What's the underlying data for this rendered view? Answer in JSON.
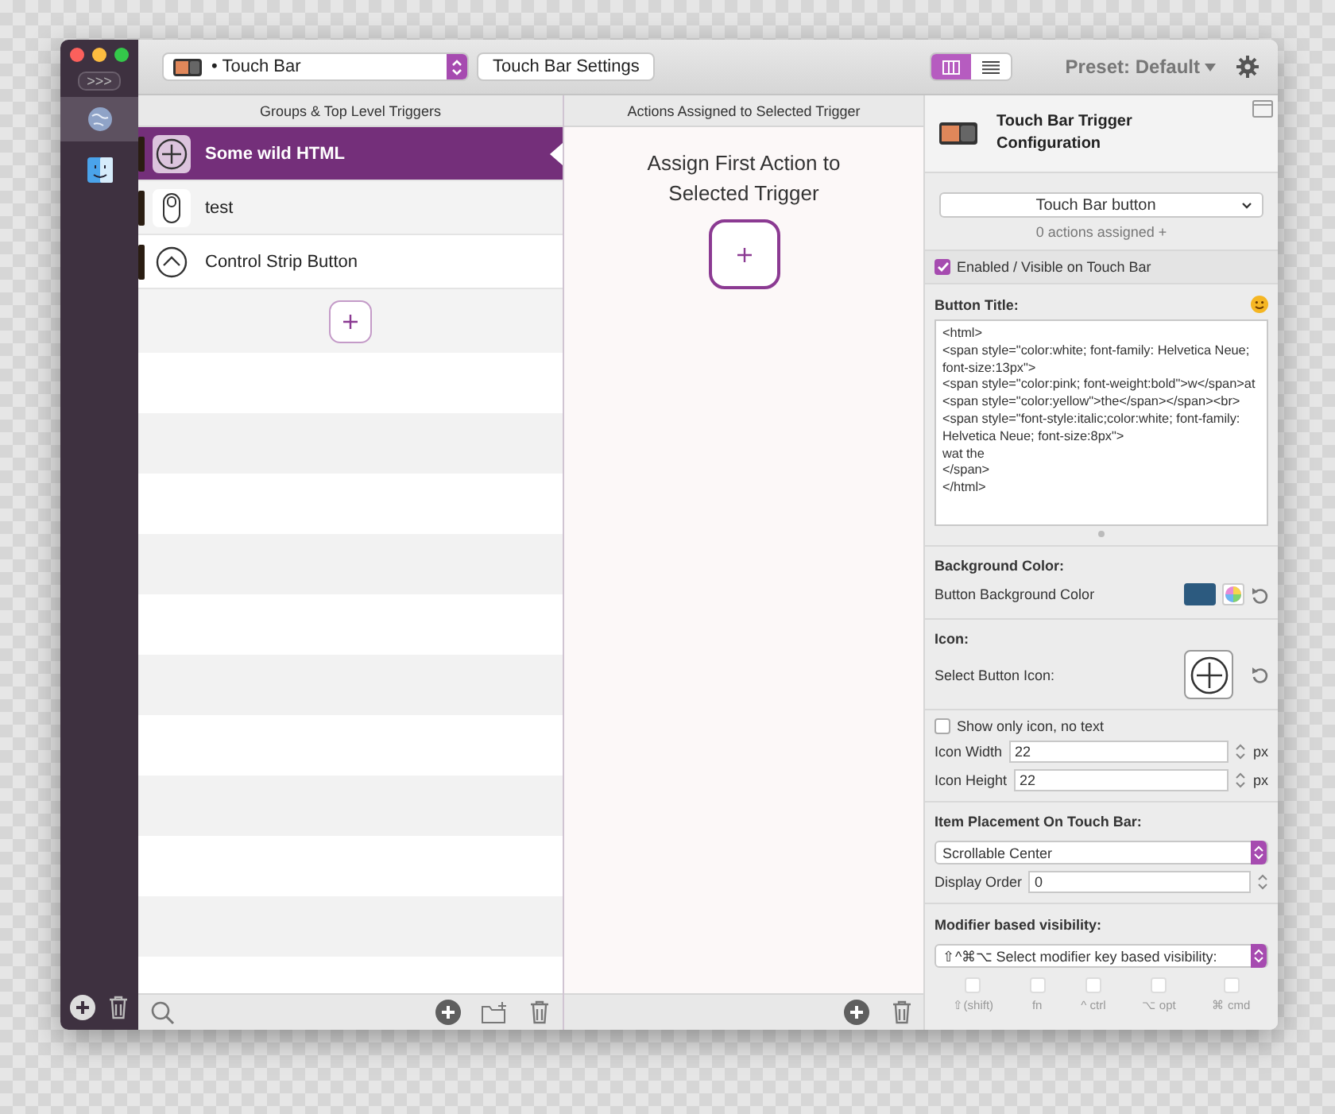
{
  "sidebar": {
    "expand_label": ">>>",
    "apps": [
      {
        "kind": "globe",
        "selected": true
      },
      {
        "kind": "finder",
        "selected": false
      }
    ]
  },
  "toolbar": {
    "device": "• Touch Bar",
    "settings_button": "Touch Bar Settings",
    "view_modes": [
      {
        "kind": "columns",
        "selected": true
      },
      {
        "kind": "list",
        "selected": false
      }
    ],
    "preset": "Preset: Default"
  },
  "triggers_header": "Groups & Top Level Triggers",
  "triggers": [
    {
      "kind": "plus",
      "title": "Some wild HTML",
      "selected": true
    },
    {
      "kind": "mouse",
      "title": "test",
      "selected": false
    },
    {
      "kind": "chevron",
      "title": "Control Strip Button",
      "selected": false
    }
  ],
  "actions_header": "Actions Assigned to Selected Trigger",
  "actions_message": "Assign First Action to Selected Trigger",
  "config": {
    "title": "Touch Bar Trigger Configuration",
    "type_select": "Touch Bar button",
    "actions_count": "0 actions assigned +",
    "enabled": {
      "label": "Enabled / Visible on Touch Bar",
      "checked": true
    },
    "button_title_label": "Button Title:",
    "button_title_value": "<html>\n<span style=\"color:white; font-family: Helvetica Neue; font-size:13px\">\n<span style=\"color:pink; font-weight:bold\">w</span>at <span style=\"color:yellow\">the</span></span><br>\n<span style=\"font-style:italic;color:white; font-family: Helvetica Neue; font-size:8px\">\nwat the\n</span>\n</html>",
    "background_label": "Background Color:",
    "background_row_label": "Button Background Color",
    "icon_label": "Icon:",
    "select_icon_label": "Select Button Icon:",
    "icon_only": {
      "label": "Show only icon, no text",
      "checked": false
    },
    "icon_width": {
      "label": "Icon Width",
      "value": "22",
      "unit": "px"
    },
    "icon_height": {
      "label": "Icon Height",
      "value": "22",
      "unit": "px"
    },
    "placement_label": "Item Placement On Touch Bar:",
    "placement_select": "Scrollable Center",
    "display_order": {
      "label": "Display Order",
      "value": "0"
    },
    "modifier_label": "Modifier based visibility:",
    "modifier_select": "⇧^⌘⌥ Select modifier key based visibility:",
    "modifiers": [
      {
        "label": "⇧(shift)",
        "checked": false,
        "disabled": true
      },
      {
        "label": "fn",
        "checked": false,
        "disabled": true
      },
      {
        "label": "^ ctrl",
        "checked": false,
        "disabled": true
      },
      {
        "label": "⌥ opt",
        "checked": false,
        "disabled": true
      },
      {
        "label": "⌘ cmd",
        "checked": false,
        "disabled": true
      }
    ]
  }
}
